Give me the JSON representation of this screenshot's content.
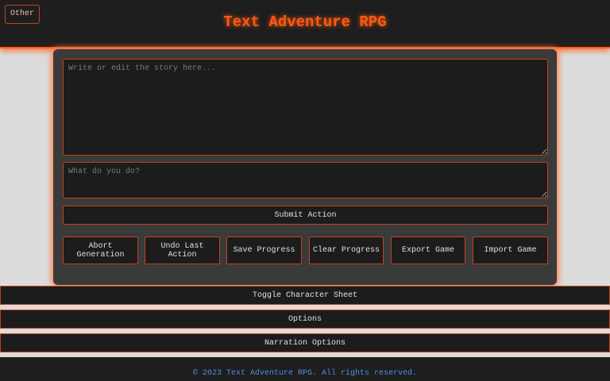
{
  "header": {
    "title": "Text Adventure RPG",
    "other_button": "Other"
  },
  "story": {
    "placeholder": "Write or edit the story here...",
    "value": ""
  },
  "action": {
    "placeholder": "What do you do?",
    "value": "",
    "submit": "Submit Action"
  },
  "controls": [
    "Abort Generation",
    "Undo Last Action",
    "Save Progress",
    "Clear Progress",
    "Export Game",
    "Import Game"
  ],
  "panels": {
    "character": "Toggle Character Sheet",
    "options": "Options",
    "narration": "Narration Options"
  },
  "footer": {
    "text": "© 2023 Text Adventure RPG. All rights reserved."
  },
  "colors": {
    "accent": "#ff5a10",
    "footer_text": "#4a90e2"
  }
}
